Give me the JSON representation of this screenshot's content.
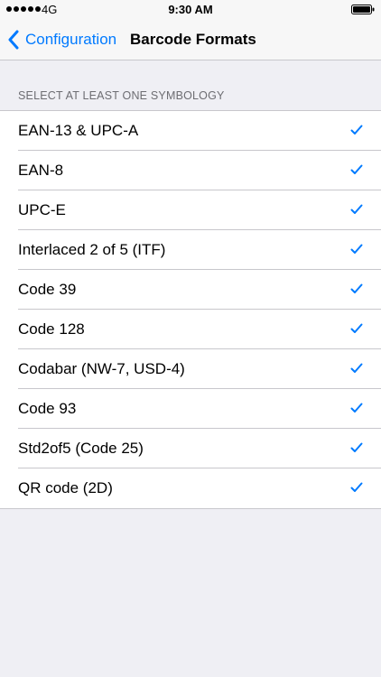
{
  "status_bar": {
    "signal_bars": 5,
    "carrier": "4G",
    "time": "9:30 AM",
    "battery_icon": "battery-full-icon"
  },
  "nav": {
    "back_label": "Configuration",
    "title": "Barcode Formats"
  },
  "section": {
    "header": "SELECT AT LEAST ONE SYMBOLOGY"
  },
  "formats": [
    {
      "label": "EAN-13 & UPC-A",
      "checked": true
    },
    {
      "label": "EAN-8",
      "checked": true
    },
    {
      "label": "UPC-E",
      "checked": true
    },
    {
      "label": "Interlaced 2 of 5 (ITF)",
      "checked": true
    },
    {
      "label": "Code 39",
      "checked": true
    },
    {
      "label": "Code 128",
      "checked": true
    },
    {
      "label": "Codabar (NW-7, USD-4)",
      "checked": true
    },
    {
      "label": "Code 93",
      "checked": true
    },
    {
      "label": "Std2of5 (Code 25)",
      "checked": true
    },
    {
      "label": "QR code (2D)",
      "checked": true
    }
  ],
  "colors": {
    "accent": "#007aff",
    "background": "#efeff4",
    "separator": "#c8c7cc"
  }
}
